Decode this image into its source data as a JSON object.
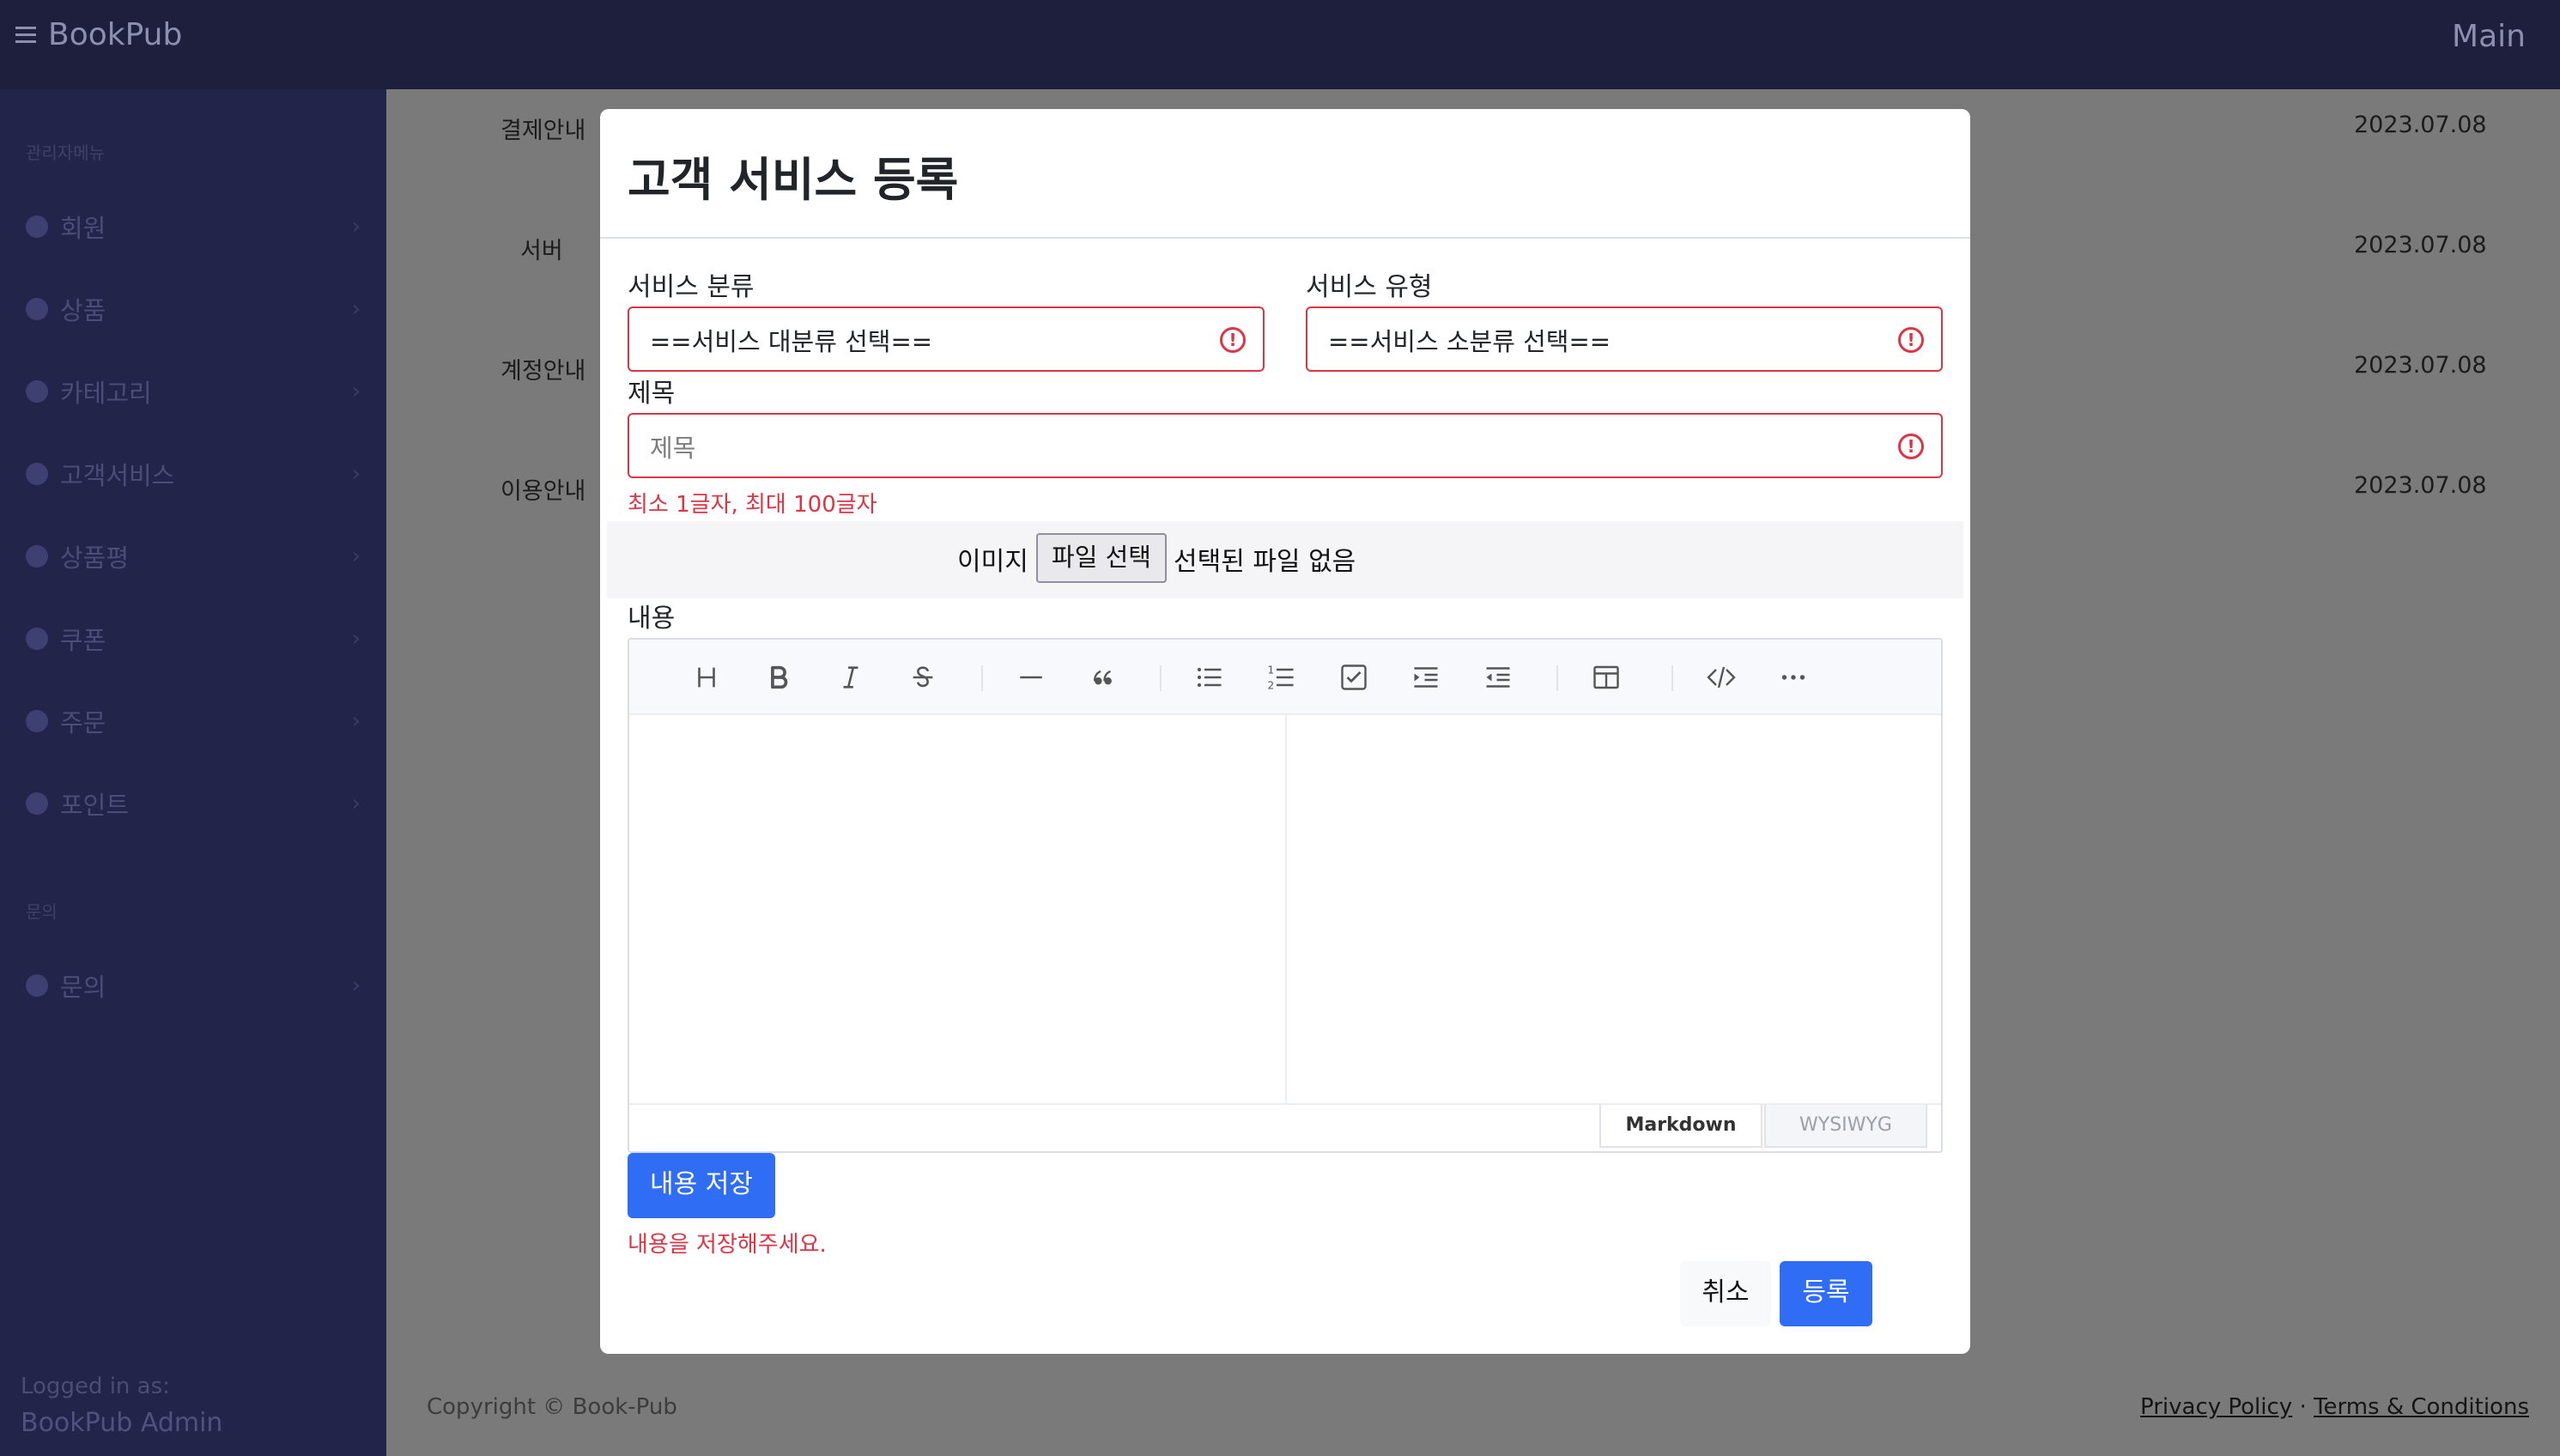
{
  "topbar": {
    "brand": "BookPub",
    "right_title": "Main"
  },
  "sidebar": {
    "section1": "관리자메뉴",
    "items": [
      {
        "label": "회원"
      },
      {
        "label": "상품"
      },
      {
        "label": "카테고리"
      },
      {
        "label": "고객서비스"
      },
      {
        "label": "상품평"
      },
      {
        "label": "쿠폰"
      },
      {
        "label": "주문"
      },
      {
        "label": "포인트"
      }
    ],
    "section2": "문의",
    "items2": [
      {
        "label": "문의"
      }
    ],
    "logged_in_label": "Logged in as:",
    "logged_in_user": "BookPub Admin"
  },
  "list": {
    "rows": [
      {
        "title": "결제안내",
        "date": "2023.07.08"
      },
      {
        "title": "서버",
        "date": "2023.07.08"
      },
      {
        "title": "계정안내",
        "date": "2023.07.08"
      },
      {
        "title": "이용안내",
        "date": "2023.07.08"
      }
    ]
  },
  "footer": {
    "copyright": "Copyright © Book-Pub",
    "privacy": "Privacy Policy",
    "sep": "·",
    "terms": "Terms & Conditions"
  },
  "modal": {
    "title": "고객 서비스 등록",
    "category_label": "서비스 분류",
    "category_value": "==서비스 대분류 선택==",
    "type_label": "서비스 유형",
    "type_value": "==서비스 소분류 선택==",
    "subject_label": "제목",
    "subject_placeholder": "제목",
    "subject_error": "최소 1글자, 최대 100글자",
    "image_label": "이미지",
    "file_button": "파일 선택",
    "file_status": "선택된 파일 없음",
    "content_label": "내용",
    "editor_modes": {
      "markdown": "Markdown",
      "wysiwyg": "WYSIWYG"
    },
    "save_content_button": "내용 저장",
    "content_error": "내용을 저장해주세요.",
    "cancel_button": "취소",
    "submit_button": "등록"
  },
  "colors": {
    "primary": "#2f6df5",
    "danger": "#dc3545",
    "sidebar": "#23244a",
    "topbar": "#1e1f3d"
  }
}
